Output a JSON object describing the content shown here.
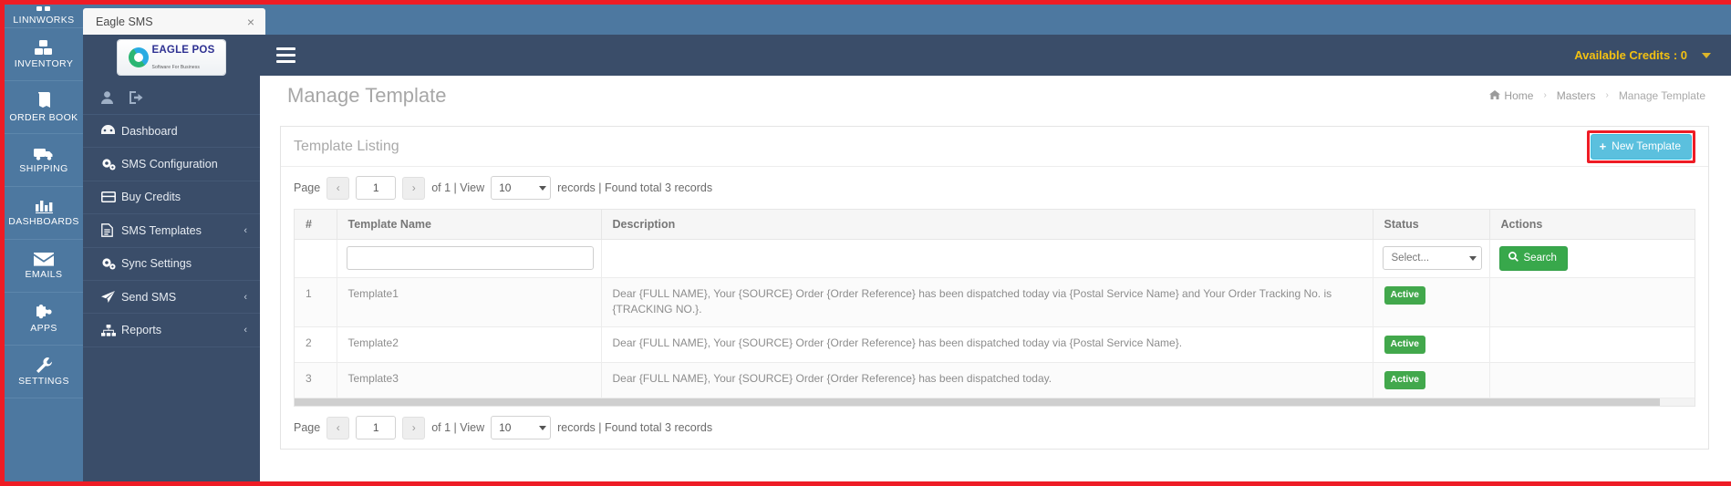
{
  "launcher": {
    "items": [
      {
        "label": "LINNWORKS",
        "icon": "linnworks-icon"
      },
      {
        "label": "INVENTORY",
        "icon": "boxes-icon"
      },
      {
        "label": "ORDER BOOK",
        "icon": "book-icon"
      },
      {
        "label": "SHIPPING",
        "icon": "truck-icon"
      },
      {
        "label": "DASHBOARDS",
        "icon": "bar-chart-icon"
      },
      {
        "label": "EMAILS",
        "icon": "envelope-icon"
      },
      {
        "label": "APPS",
        "icon": "puzzle-icon"
      },
      {
        "label": "SETTINGS",
        "icon": "wrench-icon"
      }
    ]
  },
  "tab": {
    "title": "Eagle SMS",
    "close": "×"
  },
  "brand": {
    "name": "EAGLE POS",
    "tagline": "Software For Business"
  },
  "sidebar": {
    "user_icon": "user-icon",
    "logout_icon": "logout-icon",
    "items": [
      {
        "label": "Dashboard",
        "icon": "dashboard-icon",
        "caret": ""
      },
      {
        "label": "SMS Configuration",
        "icon": "gears-icon",
        "caret": ""
      },
      {
        "label": "Buy Credits",
        "icon": "credit-card-icon",
        "caret": ""
      },
      {
        "label": "SMS Templates",
        "icon": "file-text-icon",
        "caret": "‹"
      },
      {
        "label": "Sync Settings",
        "icon": "gears-icon",
        "caret": ""
      },
      {
        "label": "Send SMS",
        "icon": "paper-plane-icon",
        "caret": "‹"
      },
      {
        "label": "Reports",
        "icon": "sitemap-icon",
        "caret": "‹"
      }
    ]
  },
  "topbar": {
    "menu_toggle": "hamburger-icon",
    "credits_label": "Available Credits : 0",
    "caret": "caret-down-icon"
  },
  "page": {
    "title": "Manage Template",
    "breadcrumb": [
      {
        "label": "Home",
        "icon": "home-icon"
      },
      {
        "label": "Masters",
        "icon": ""
      },
      {
        "label": "Manage Template",
        "icon": ""
      }
    ],
    "breadcrumb_separator": "›"
  },
  "panel": {
    "title": "Template Listing",
    "new_template_label": "New Template",
    "new_template_plus": "+"
  },
  "pager": {
    "page_word": "Page",
    "prev": "‹",
    "next": "›",
    "page_value": "1",
    "of_view": "of 1 | View",
    "view_value": "10",
    "records_total": "records | Found total 3 records"
  },
  "table": {
    "headers": [
      "#",
      "Template Name",
      "Description",
      "Status",
      "Actions"
    ],
    "filters": {
      "name_value": "",
      "name_placeholder": "",
      "status_value": "Select...",
      "search_label": "Search",
      "search_icon": "magnifier-icon"
    },
    "rows": [
      {
        "num": "1",
        "name": "Template1",
        "description": "Dear {FULL NAME}, Your {SOURCE} Order {Order Reference} has been dispatched today via {Postal Service Name} and Your Order Tracking No. is {TRACKING NO.}.",
        "status": "Active"
      },
      {
        "num": "2",
        "name": "Template2",
        "description": "Dear {FULL NAME}, Your {SOURCE} Order {Order Reference} has been dispatched today via {Postal Service Name}.",
        "status": "Active"
      },
      {
        "num": "3",
        "name": "Template3",
        "description": "Dear {FULL NAME}, Your {SOURCE} Order {Order Reference} has been dispatched today.",
        "status": "Active"
      }
    ]
  },
  "colors": {
    "rail_blue": "#4d78a0",
    "sidebar_dark": "#3a4d69",
    "accent_info": "#5bc0de",
    "accent_success": "#42a84c",
    "credits_yellow": "#f3c111",
    "highlight_red": "#ee1c25"
  }
}
